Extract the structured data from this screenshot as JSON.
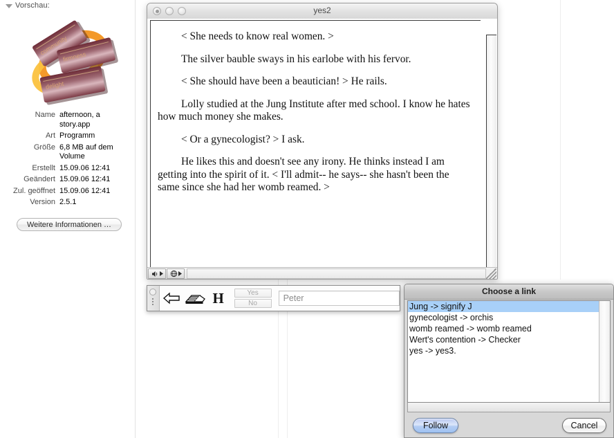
{
  "sidebar": {
    "preview_label": "Vorschau:",
    "icon": {
      "name": "afternoon-story-app-icon",
      "tile_labels": [
        "community",
        "firmness",
        "delight"
      ],
      "tile_color": "#8d4b57",
      "ribbon_color": "#f59b2a"
    },
    "info_rows": [
      {
        "label": "Name",
        "value": "afternoon, a story.app"
      },
      {
        "label": "Art",
        "value": "Programm"
      },
      {
        "label": "Größe",
        "value": "6,8 MB auf dem Volume"
      },
      {
        "label": "Erstellt",
        "value": "15.09.06 12:41"
      },
      {
        "label": "Geändert",
        "value": "15.09.06 12:41"
      },
      {
        "label": "Zul. geöffnet",
        "value": "15.09.06 12:41"
      },
      {
        "label": "Version",
        "value": "2.5.1"
      }
    ],
    "more_info_button": "Weitere Informationen …"
  },
  "document_window": {
    "title": "yes2",
    "window_buttons": [
      "close-button",
      "minimize-button",
      "zoom-button"
    ],
    "paragraphs": [
      "< She needs to know real women. >",
      "The silver bauble sways in his earlobe with his fervor.",
      "< She should have been a beautician! >  He rails.",
      "Lolly studied at the Jung Institute after med school.  I know he hates how much money she makes.",
      "< Or a gynecologist? > I ask.",
      "He likes this and doesn't see any irony.  He thinks instead I am getting into the spirit of it.  < I'll admit-- he says-- she hasn't been the same since she had her womb  reamed. >"
    ],
    "status_tools": [
      "speaker-icon",
      "globe-icon"
    ]
  },
  "toolbar": {
    "icons": [
      {
        "name": "back-arrow-icon",
        "glyph": "⇦"
      },
      {
        "name": "book-stack-icon",
        "glyph": "book"
      },
      {
        "name": "history-icon",
        "glyph": "H"
      }
    ],
    "yes_label": "Yes",
    "no_label": "No",
    "name_field_value": "Peter"
  },
  "link_dialog": {
    "title": "Choose a link",
    "links": [
      {
        "text": "Jung ->  signify J",
        "selected": true
      },
      {
        "text": "gynecologist ->  orchis",
        "selected": false
      },
      {
        "text": "womb reamed ->  womb reamed",
        "selected": false
      },
      {
        "text": "Wert's contention ->  Checker",
        "selected": false
      },
      {
        "text": "yes ->  yes3.",
        "selected": false
      }
    ],
    "follow_label": "Follow",
    "cancel_label": "Cancel",
    "selection_color": "#a8d0f8"
  }
}
